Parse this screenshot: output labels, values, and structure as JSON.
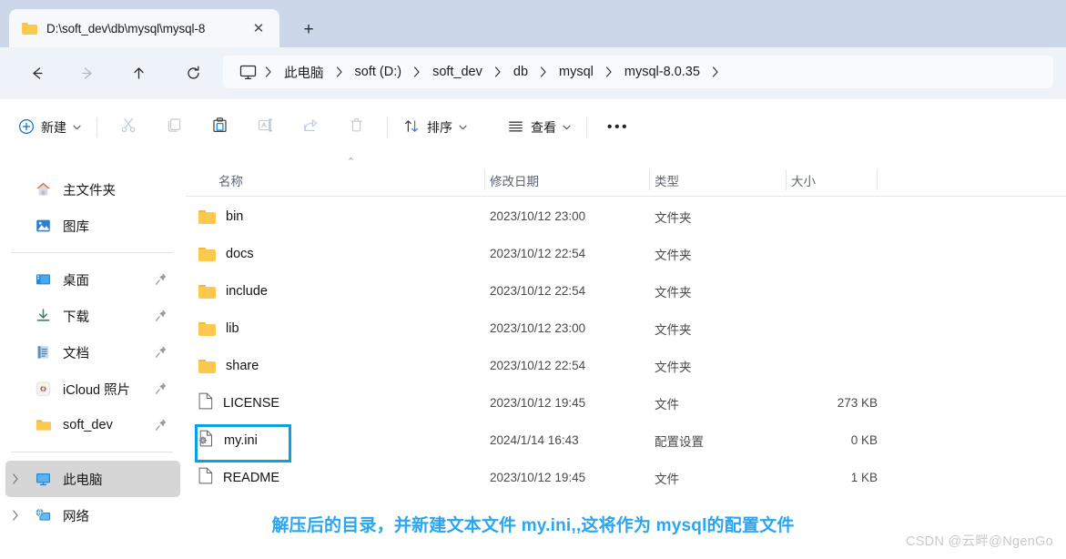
{
  "titlebar": {
    "tab_title": "D:\\soft_dev\\db\\mysql\\mysql-8",
    "tab_close_label": "✕",
    "new_tab_label": "+"
  },
  "nav": {
    "back": "back-arrow",
    "forward": "forward-arrow",
    "up": "up-arrow",
    "refresh": "refresh-arrow"
  },
  "address": {
    "root_icon": "monitor-icon",
    "crumbs": [
      {
        "label": "此电脑"
      },
      {
        "label": "soft (D:)"
      },
      {
        "label": "soft_dev"
      },
      {
        "label": "db"
      },
      {
        "label": "mysql"
      },
      {
        "label": "mysql-8.0.35"
      }
    ]
  },
  "toolbar": {
    "new_label": "新建",
    "cut_label": "cut-icon",
    "copy_label": "copy-icon",
    "paste_label": "paste-icon",
    "rename_label": "rename-icon",
    "share_label": "share-icon",
    "delete_label": "delete-icon",
    "sort_label": "排序",
    "view_label": "查看",
    "more_label": "•••",
    "chevron": "⌄"
  },
  "sidebar": {
    "items": [
      {
        "label": "主文件夹",
        "icon": "home-icon",
        "pinned": false,
        "expandable": false,
        "selected": false
      },
      {
        "label": "图库",
        "icon": "gallery-icon",
        "pinned": false,
        "expandable": false,
        "selected": false
      },
      {
        "label": "桌面",
        "icon": "desktop-icon",
        "pinned": true,
        "expandable": false,
        "selected": false
      },
      {
        "label": "下载",
        "icon": "downloads-icon",
        "pinned": true,
        "expandable": false,
        "selected": false
      },
      {
        "label": "文档",
        "icon": "documents-icon",
        "pinned": true,
        "expandable": false,
        "selected": false
      },
      {
        "label": "iCloud 照片",
        "icon": "icloud-photos-icon",
        "pinned": true,
        "expandable": false,
        "selected": false
      },
      {
        "label": "soft_dev",
        "icon": "folder-icon",
        "pinned": true,
        "expandable": false,
        "selected": false
      },
      {
        "label": "此电脑",
        "icon": "this-pc-icon",
        "pinned": false,
        "expandable": true,
        "selected": true
      },
      {
        "label": "网络",
        "icon": "network-icon",
        "pinned": false,
        "expandable": true,
        "selected": false
      }
    ],
    "pin_glyph": "📌"
  },
  "columns": {
    "name": "名称",
    "date": "修改日期",
    "type": "类型",
    "size": "大小",
    "sort_indicator": "⌃"
  },
  "files": [
    {
      "name": "bin",
      "date": "2023/10/12 23:00",
      "type": "文件夹",
      "size": "",
      "icon": "folder-icon",
      "highlighted": false
    },
    {
      "name": "docs",
      "date": "2023/10/12 22:54",
      "type": "文件夹",
      "size": "",
      "icon": "folder-icon",
      "highlighted": false
    },
    {
      "name": "include",
      "date": "2023/10/12 22:54",
      "type": "文件夹",
      "size": "",
      "icon": "folder-icon",
      "highlighted": false
    },
    {
      "name": "lib",
      "date": "2023/10/12 23:00",
      "type": "文件夹",
      "size": "",
      "icon": "folder-icon",
      "highlighted": false
    },
    {
      "name": "share",
      "date": "2023/10/12 22:54",
      "type": "文件夹",
      "size": "",
      "icon": "folder-icon",
      "highlighted": false
    },
    {
      "name": "LICENSE",
      "date": "2023/10/12 19:45",
      "type": "文件",
      "size": "273 KB",
      "icon": "file-icon",
      "highlighted": false
    },
    {
      "name": "my.ini",
      "date": "2024/1/14 16:43",
      "type": "配置设置",
      "size": "0 KB",
      "icon": "config-file-icon",
      "highlighted": true
    },
    {
      "name": "README",
      "date": "2023/10/12 19:45",
      "type": "文件",
      "size": "1 KB",
      "icon": "file-icon",
      "highlighted": false
    }
  ],
  "annotation": {
    "text": "解压后的目录，并新建文本文件 my.ini,,这将作为 mysql的配置文件",
    "color": "#2aa5ef"
  },
  "watermark": {
    "text": "CSDN @云畔@NgenGo"
  },
  "colors": {
    "titlebar_bg": "#ccd7e9",
    "navbar_bg": "#eef2f9",
    "accent": "#0aa1e0",
    "folder": "#fcc84e"
  }
}
